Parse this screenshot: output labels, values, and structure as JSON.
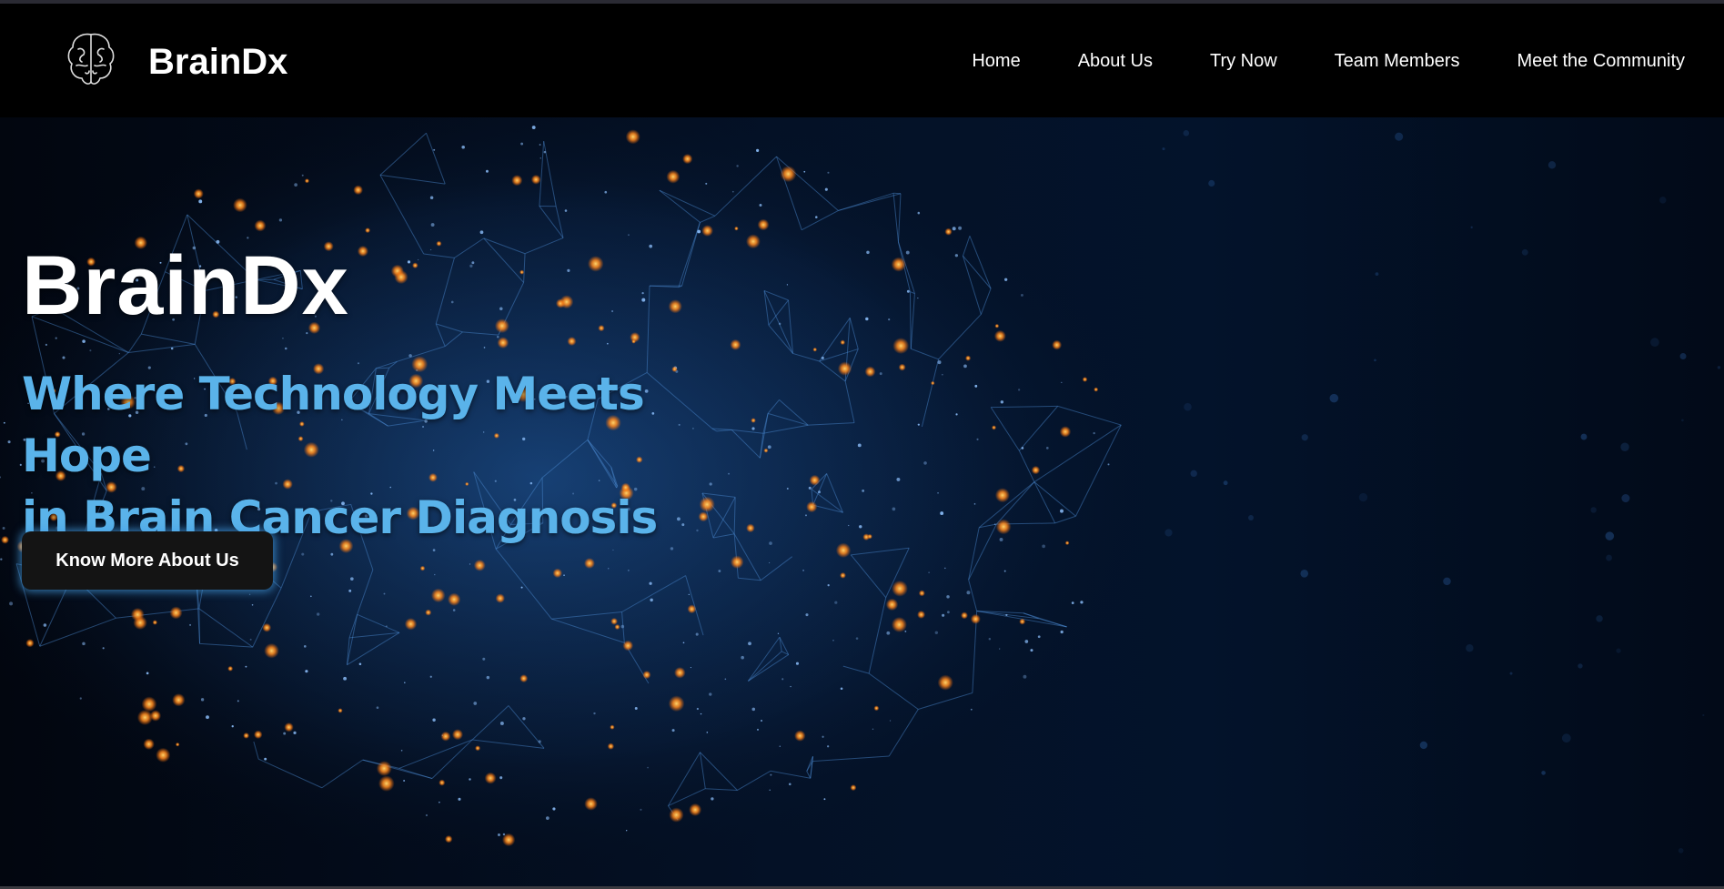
{
  "header": {
    "brand": "BrainDx",
    "logo_icon": "brain-outline-icon",
    "nav": [
      {
        "label": "Home"
      },
      {
        "label": "About Us"
      },
      {
        "label": "Try Now"
      },
      {
        "label": "Team Members"
      },
      {
        "label": "Meet the Community"
      }
    ]
  },
  "hero": {
    "title": "BrainDx",
    "subtitle_line1": "Where Technology Meets Hope",
    "subtitle_line2": "in Brain Cancer Diagnosis",
    "button_label": "Know More About Us",
    "background": "glowing-neural-brain-network"
  },
  "colors": {
    "background": "#000000",
    "accent_blue": "#5ab3ea",
    "button_bg": "#141414",
    "glow": "#46a0e6",
    "node_orange": "#ff9a2e"
  }
}
